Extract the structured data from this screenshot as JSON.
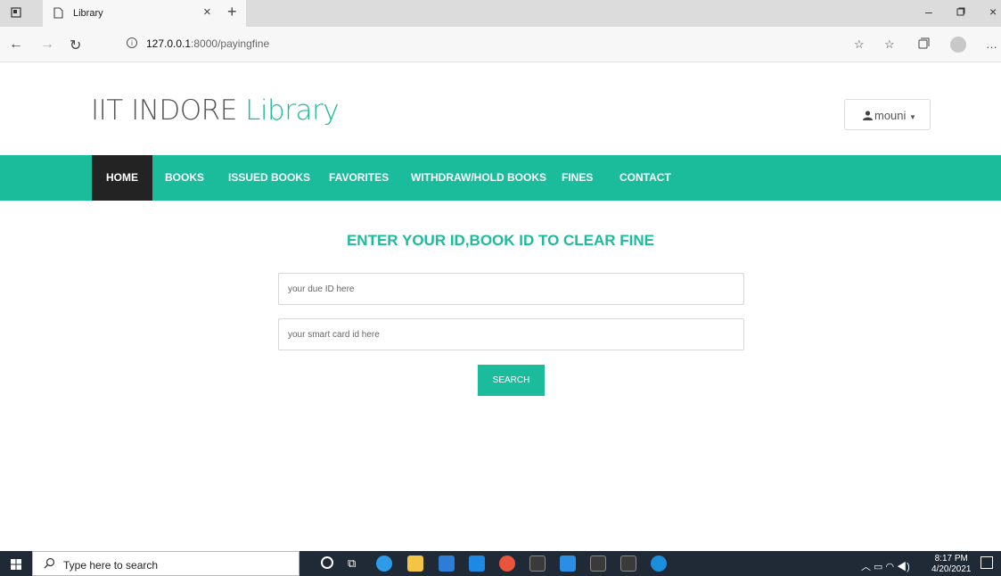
{
  "browser": {
    "tab_title": "Library",
    "url_host": "127.0.0.1",
    "url_path": ":8000/payingfine"
  },
  "site": {
    "brand_main": "IIT INDORE",
    "brand_accent": "Library",
    "user": "mouni",
    "nav": [
      {
        "label": "HOME"
      },
      {
        "label": "BOOKS"
      },
      {
        "label": "ISSUED BOOKS"
      },
      {
        "label": "FAVORITES"
      },
      {
        "label": "WITHDRAW/HOLD BOOKS"
      },
      {
        "label": "FINES"
      },
      {
        "label": "CONTACT"
      }
    ]
  },
  "form": {
    "heading": "ENTER YOUR ID,BOOK ID TO CLEAR FINE",
    "due_id_placeholder": "your due ID here",
    "card_id_placeholder": "your smart card id here",
    "submit_label": "SEARCH"
  },
  "taskbar": {
    "search_placeholder": "Type here to search",
    "time": "8:17 PM",
    "date": "4/20/2021"
  },
  "colors": {
    "accent": "#1abc9c",
    "nav_active": "#232323"
  }
}
